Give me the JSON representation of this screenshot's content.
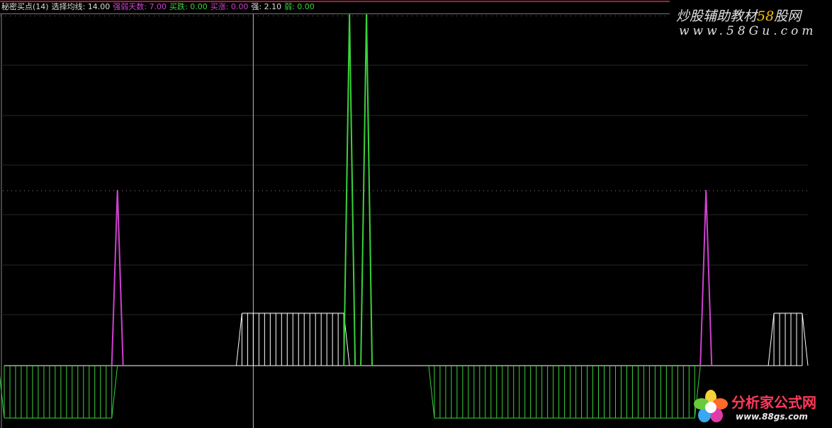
{
  "header": {
    "items": [
      {
        "label": "秘密买点(14)",
        "color": "#dddddd"
      },
      {
        "label": "选择均线: 14.00",
        "color": "#dddddd"
      },
      {
        "label": "强弱天数: 7.00",
        "color": "#d040d0"
      },
      {
        "label": "买跌: 0.00",
        "color": "#3ad33a"
      },
      {
        "label": "买涨: 0.00",
        "color": "#d040d0"
      },
      {
        "label": "强: 2.10",
        "color": "#dddddd"
      },
      {
        "label": "弱: 0.00",
        "color": "#3ad33a"
      }
    ]
  },
  "watermark": {
    "prefix": "炒股辅助教材",
    "number": "58",
    "suffix": "股网",
    "url": "www.58Gu.com"
  },
  "logo": {
    "icon": "flower-icon",
    "text": "分析家公式网",
    "url": "www.88gs.com"
  },
  "colors": {
    "background": "#000000",
    "green": "#3ad33a",
    "magenta": "#d040d0",
    "white": "#ffffff",
    "grid": "#555555",
    "yellow": "#f6c400"
  },
  "chart_data": {
    "type": "bar",
    "ylim": [
      -1,
      6.7
    ],
    "grid": "dotted horizontal",
    "markers": [
      {
        "type": "vertical-cursor",
        "x": 44
      }
    ],
    "series": [
      {
        "style": "stick-band",
        "color": "#3ad33a",
        "bands": [
          {
            "start": 0,
            "end": 19,
            "value": -1
          },
          {
            "start": 76,
            "end": 122,
            "value": -1
          }
        ]
      },
      {
        "style": "stick-band",
        "color": "#ffffff",
        "bands": [
          {
            "start": 42,
            "end": 60,
            "value": 1
          },
          {
            "start": 136,
            "end": 141,
            "value": 1
          }
        ]
      },
      {
        "style": "spike",
        "color": "#d040d0",
        "spikes": [
          {
            "x": 20,
            "value": 3.35
          },
          {
            "x": 124,
            "value": 3.35
          }
        ]
      },
      {
        "style": "spike",
        "color": "#3ad33a",
        "spikes": [
          {
            "x": 61,
            "value": 6.7
          },
          {
            "x": 64,
            "value": 6.7
          }
        ]
      }
    ]
  }
}
